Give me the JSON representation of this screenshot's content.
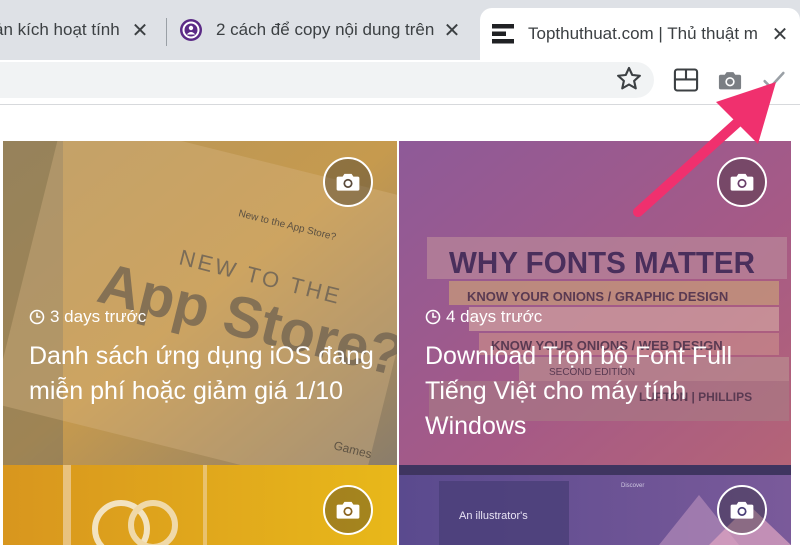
{
  "browser": {
    "tabs": [
      {
        "title": "ản kích hoạt tính",
        "active": false
      },
      {
        "title": "2 cách để copy nội dung trên",
        "active": false
      },
      {
        "title": "Topthuthuat.com | Thủ thuật m",
        "active": true
      }
    ],
    "close_glyph": "✕"
  },
  "feed": {
    "cards": [
      {
        "time": "3 days trước",
        "title": "Danh sách ứng dụng iOS đang miễn phí hoặc giảm giá 1/10",
        "image_text": {
          "line1": "NEW TO THE",
          "line2": "App Store?",
          "line3": "New to the App Store?",
          "line4": "Games"
        }
      },
      {
        "time": "4 days trước",
        "title": "Download Trọn bộ Font Full Tiếng Việt cho máy tính Windows",
        "image_text": {
          "line1": "WHY FONTS MATTER",
          "line2": "KNOW YOUR ONIONS / GRAPHIC DESIGN",
          "line3": "KNOW YOUR ONIONS / WEB DESIGN",
          "line4": "SECOND EDITION",
          "line5": "LUPTON | PHILLIPS"
        }
      },
      {
        "time": "",
        "title": "",
        "image_text": {}
      },
      {
        "time": "",
        "title": "",
        "image_text": {
          "line1": "An illustrator's",
          "line2": "Discover"
        }
      }
    ]
  },
  "colors": {
    "arrow": "#f0306e",
    "tab_strip": "#dee1e6",
    "omnibox": "#f1f3f4",
    "card1_tint": "#c79a4f",
    "card2_tint": "#9d5a8f"
  },
  "icons": {
    "star": "bookmark-star-icon",
    "ext1": "layout-grid-icon",
    "ext2": "camera-icon",
    "ext3": "checkmark-icon",
    "camera_badge": "camera-icon",
    "clock": "clock-icon"
  }
}
